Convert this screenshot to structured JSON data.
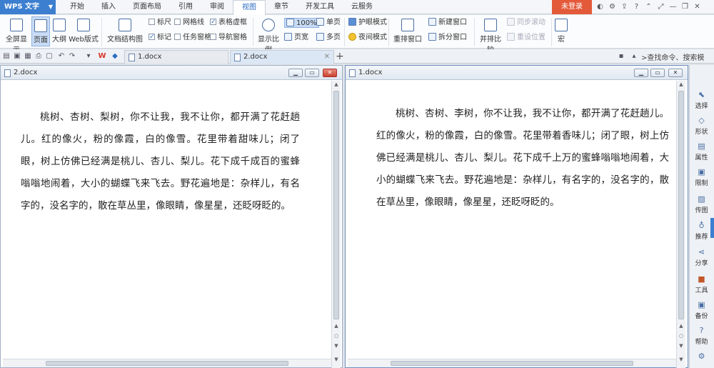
{
  "app": {
    "name": "WPS 文字",
    "menu": [
      "开始",
      "插入",
      "页面布局",
      "引用",
      "审阅",
      "视图",
      "章节",
      "开发工具",
      "云服务"
    ],
    "active_menu": "视图",
    "login_label": "未登录"
  },
  "ribbon": {
    "fullscreen": "全屏显示",
    "page_view": "页面",
    "outline": "大纲",
    "web_layout": "Web版式",
    "doc_structure": "文档结构图",
    "ruler": "标尺",
    "gridlines": "网格线",
    "table_borders": "表格虚框",
    "markers": "标记",
    "task_pane": "任务窗格",
    "nav_pane": "导航窗格",
    "zoom": "显示比例",
    "zoom_value": "100%",
    "page_width": "页宽",
    "single_page": "单页",
    "multi_page": "多页",
    "eye_protect": "护眼模式",
    "night_mode": "夜间模式",
    "arrange_windows": "重排窗口",
    "new_window": "新建窗口",
    "split_window": "拆分窗口",
    "side_by_side": "并排比较",
    "sync_scroll": "同步滚动",
    "reset_position": "重设位置",
    "macro": "宏"
  },
  "tabs": [
    "1.docx",
    "2.docx"
  ],
  "search_label": ">查找命令、搜索模",
  "left_doc": {
    "title": "2.docx",
    "text": "桃树、杏树、梨树，你不让我，我不让你，都开满了花赶趟儿。红的像火，粉的像霞，白的像雪。花里带着甜味儿；闭了眼，树上仿佛已经满是桃儿、杏儿、梨儿。花下成千成百的蜜蜂嗡嗡地闹着，大小的蝴蝶飞来飞去。野花遍地是：杂样儿，有名字的，没名字的，散在草丛里，像眼睛，像星星，还眨呀眨的。"
  },
  "right_doc": {
    "title": "1.docx",
    "text": "桃树、杏树、李树，你不让我，我不让你，都开满了花赶趟儿。红的像火，粉的像霞，白的像雪。花里带着香味儿；闭了眼，树上仿佛已经满是桃儿、杏儿、梨儿。花下成千上万的蜜蜂嗡嗡地闹着，大小的蝴蝶飞来飞去。野花遍地是：杂样儿，有名字的，没名字的，散在草丛里，像眼睛，像星星，还眨呀眨的。"
  },
  "side_panel": [
    "选择",
    "形状",
    "属性",
    "限制",
    "传图",
    "推荐",
    "分享",
    "工具",
    "备份",
    "帮助"
  ]
}
